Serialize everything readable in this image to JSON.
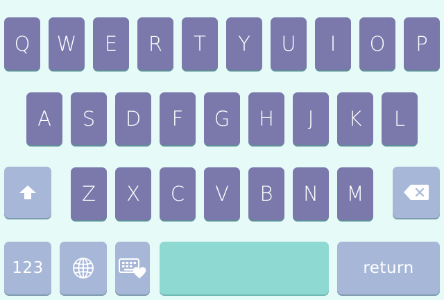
{
  "keyboard": {
    "rows": [
      [
        "Q",
        "W",
        "E",
        "R",
        "T",
        "Y",
        "U",
        "I",
        "O",
        "P"
      ],
      [
        "A",
        "S",
        "D",
        "F",
        "G",
        "H",
        "J",
        "K",
        "L"
      ],
      [
        "Z",
        "X",
        "C",
        "V",
        "B",
        "N",
        "M"
      ]
    ],
    "numbers_label": "123",
    "return_label": "return",
    "icons": {
      "shift": "shift-arrow-icon",
      "backspace": "backspace-icon",
      "globe": "globe-icon",
      "emoji_keyboard": "keyboard-heart-icon"
    },
    "colors": {
      "background": "#e6fbf8",
      "letter_key": "#7b79ab",
      "function_key": "#a7b7d7",
      "space_key": "#8fd9d3",
      "key_text": "#ffffff"
    }
  }
}
